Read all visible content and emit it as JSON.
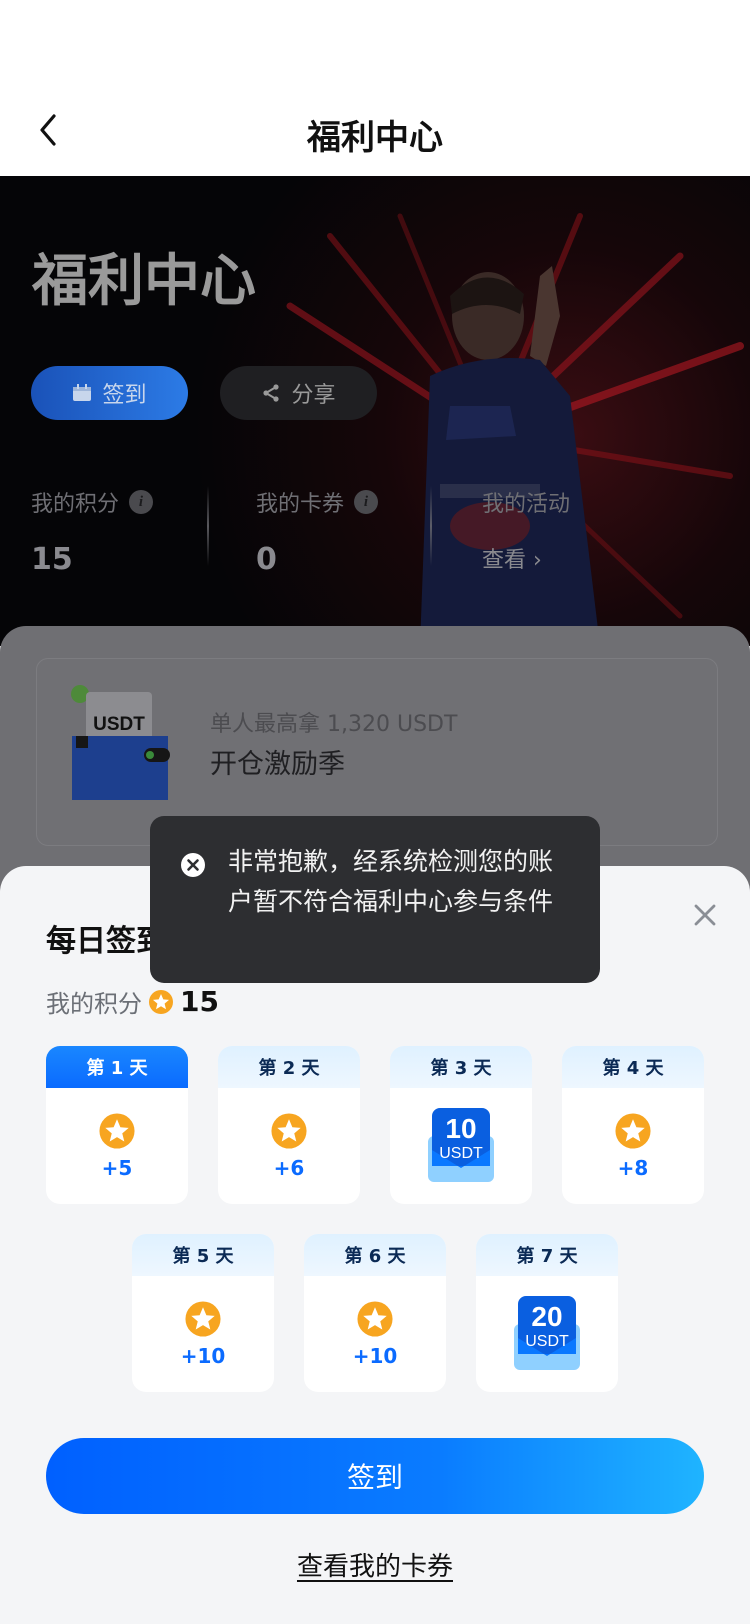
{
  "header": {
    "title": "福利中心"
  },
  "hero": {
    "title": "福利中心",
    "checkin_label": "签到",
    "share_label": "分享",
    "stats": [
      {
        "label": "我的积分",
        "value": "15"
      },
      {
        "label": "我的卡券",
        "value": "0"
      },
      {
        "label": "我的活动",
        "link": "查看 ›"
      }
    ]
  },
  "promo": {
    "subtitle": "单人最高拿 1,320 USDT",
    "title": "开仓激励季",
    "badge": "USDT"
  },
  "toast": {
    "message": "非常抱歉，经系统检测您的账户暂不符合福利中心参与条件"
  },
  "sheet": {
    "title": "每日签到",
    "points_label": "我的积分",
    "points_value": "15",
    "days": [
      {
        "label": "第 1 天",
        "reward": "+5",
        "type": "points",
        "active": true
      },
      {
        "label": "第 2 天",
        "reward": "+6",
        "type": "points"
      },
      {
        "label": "第 3 天",
        "reward": "10",
        "unit": "USDT",
        "type": "coupon"
      },
      {
        "label": "第 4 天",
        "reward": "+8",
        "type": "points"
      },
      {
        "label": "第 5 天",
        "reward": "+10",
        "type": "points"
      },
      {
        "label": "第 6 天",
        "reward": "+10",
        "type": "points"
      },
      {
        "label": "第 7 天",
        "reward": "20",
        "unit": "USDT",
        "type": "coupon"
      }
    ],
    "cta_label": "签到",
    "view_coupons_label": "查看我的卡券"
  },
  "colors": {
    "accent": "#0a6bff",
    "star": "#f7a520",
    "toast_bg": "#2d2e31"
  }
}
